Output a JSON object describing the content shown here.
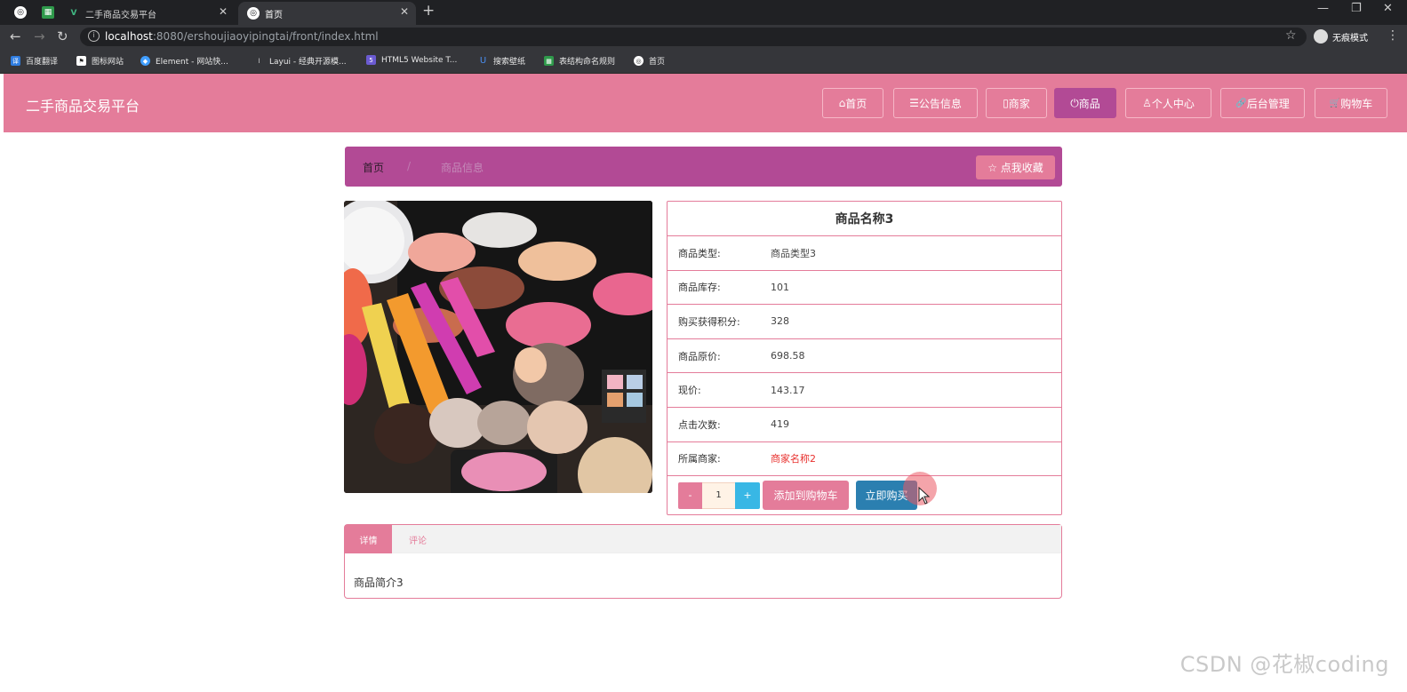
{
  "browser": {
    "tabs": [
      {
        "title": "二手商品交易平台",
        "active": false
      },
      {
        "title": "首页",
        "active": true
      }
    ],
    "url_host": "localhost",
    "url_path": ":8080/ershoujiaoyipingtai/front/index.html",
    "profile_label": "无痕模式",
    "bookmarks": [
      {
        "label": "百度翻译",
        "color": "#2f7de1"
      },
      {
        "label": "图标网站",
        "color": "#444444"
      },
      {
        "label": "Element - 网站快...",
        "color": "#409eff"
      },
      {
        "label": "Layui - 经典开源模...",
        "color": "#777777"
      },
      {
        "label": "HTML5 Website T...",
        "color": "#6b5bd2"
      },
      {
        "label": "搜索壁纸",
        "color": "#3a79d8"
      },
      {
        "label": "表结构命名规则",
        "color": "#2f9a4b"
      },
      {
        "label": "首页",
        "color": "#555555"
      }
    ]
  },
  "header": {
    "site_title": "二手商品交易平台",
    "nav": [
      {
        "label": "首页",
        "icon": "home-icon",
        "glyph": "⌂",
        "active": false
      },
      {
        "label": "公告信息",
        "icon": "announcement-icon",
        "glyph": "☰",
        "active": false
      },
      {
        "label": "商家",
        "icon": "store-icon",
        "glyph": "▯",
        "active": false
      },
      {
        "label": "商品",
        "icon": "power-icon",
        "glyph": "⏻",
        "active": true
      },
      {
        "label": "个人中心",
        "icon": "user-icon",
        "glyph": "♙",
        "active": false
      },
      {
        "label": "后台管理",
        "icon": "link-icon",
        "glyph": "🔗",
        "active": false
      },
      {
        "label": "购物车",
        "icon": "cart-icon",
        "glyph": "🛒",
        "active": false
      }
    ],
    "accent": "#e47c9a",
    "active_color": "#b24a95"
  },
  "breadcrumb": {
    "home": "首页",
    "separator": "/",
    "current": "商品信息",
    "favorite_label": "☆ 点我收藏"
  },
  "product": {
    "name": "商品名称3",
    "fields": [
      {
        "label": "商品类型:",
        "value": "商品类型3"
      },
      {
        "label": "商品库存:",
        "value": "101"
      },
      {
        "label": "购买获得积分:",
        "value": "328"
      },
      {
        "label": "商品原价:",
        "value": "698.58"
      },
      {
        "label": "现价:",
        "value": "143.17"
      },
      {
        "label": "点击次数:",
        "value": "419"
      },
      {
        "label": "所属商家:",
        "value": "商家名称2",
        "link": true
      }
    ],
    "quantity": "1",
    "minus_label": "-",
    "plus_label": "+",
    "add_cart_label": "添加到购物车",
    "buy_label": "立即购买"
  },
  "detail_tabs": {
    "tabs": [
      "详情",
      "评论"
    ],
    "content": "商品简介3"
  },
  "watermark": "CSDN @花椒coding"
}
